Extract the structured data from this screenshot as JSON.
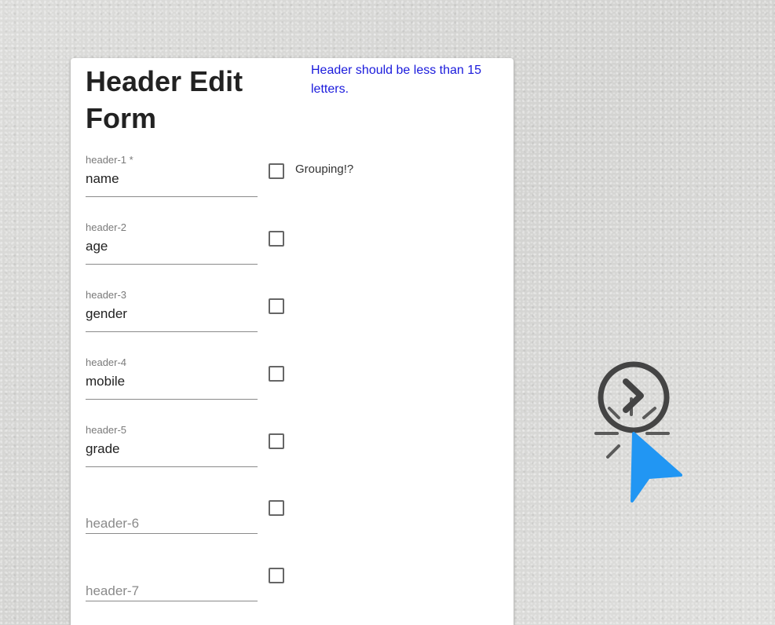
{
  "form": {
    "title": "Header Edit Form",
    "hint": "Header should be less than 15 letters.",
    "fields": [
      {
        "label": "header-1 *",
        "value": "name",
        "placeholder": "",
        "checkbox_label": "Grouping!?",
        "checked": false
      },
      {
        "label": "header-2",
        "value": "age",
        "placeholder": "",
        "checkbox_label": "",
        "checked": false
      },
      {
        "label": "header-3",
        "value": "gender",
        "placeholder": "",
        "checkbox_label": "",
        "checked": false
      },
      {
        "label": "header-4",
        "value": "mobile",
        "placeholder": "",
        "checkbox_label": "",
        "checked": false
      },
      {
        "label": "header-5",
        "value": "grade",
        "placeholder": "",
        "checkbox_label": "",
        "checked": false
      },
      {
        "label": "",
        "value": "",
        "placeholder": "header-6",
        "checkbox_label": "",
        "checked": false
      },
      {
        "label": "",
        "value": "",
        "placeholder": "header-7",
        "checkbox_label": "",
        "checked": false
      }
    ]
  },
  "overlay": {
    "icons": [
      "click-indicator-icon",
      "mouse-pointer-icon"
    ],
    "colors": {
      "ring": "#444444",
      "pointer": "#2196f3"
    }
  }
}
